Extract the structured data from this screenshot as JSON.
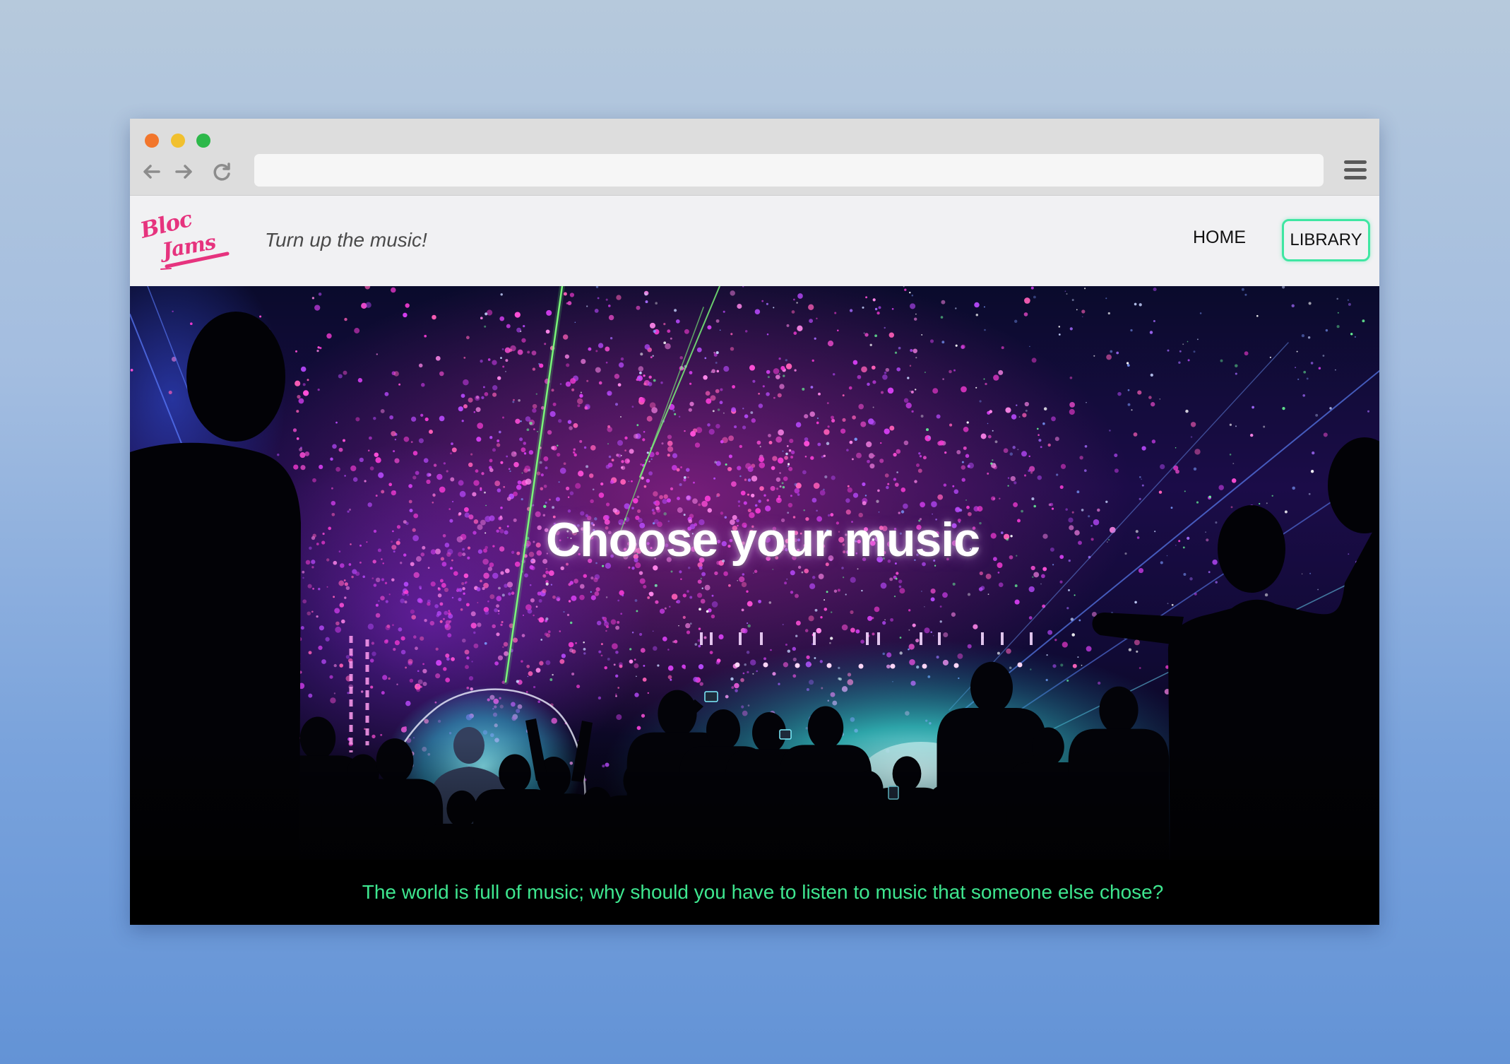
{
  "browser": {
    "icons": {
      "back": "back-arrow-icon",
      "forward": "forward-arrow-icon",
      "reload": "reload-icon",
      "menu": "hamburger-menu-icon"
    }
  },
  "app": {
    "logo": {
      "line1": "Bloc",
      "line2": "Jams",
      "color": "#e6337e"
    },
    "tagline": "Turn up the music!",
    "nav": [
      {
        "label": "HOME",
        "highlighted": false
      },
      {
        "label": "LIBRARY",
        "highlighted": true
      }
    ]
  },
  "hero": {
    "title": "Choose your music",
    "subtitle": "The world is full of music; why should you have to listen to music that someone else chose?"
  },
  "colors": {
    "accent_green": "#3ee68f",
    "library_border": "#3fe6a2",
    "header_bg": "#f1f1f3",
    "page_bg_top": "#b6c9dc",
    "page_bg_bottom": "#6393d6"
  }
}
